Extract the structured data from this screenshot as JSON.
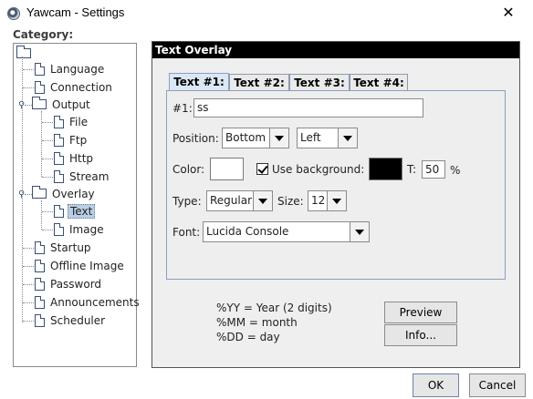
{
  "window": {
    "title": "Yawcam - Settings",
    "close": "✕"
  },
  "category_label": "Category:",
  "tree": {
    "items": {
      "language": "Language",
      "connection": "Connection",
      "output": "Output",
      "file": "File",
      "ftp": "Ftp",
      "http": "Http",
      "stream": "Stream",
      "overlay": "Overlay",
      "text": "Text",
      "image": "Image",
      "startup": "Startup",
      "offline_image": "Offline Image",
      "password": "Password",
      "announcements": "Announcements",
      "scheduler": "Scheduler"
    },
    "selected": "text"
  },
  "panel": {
    "title": "Text Overlay",
    "tabs": [
      "Text #1:",
      "Text #2:",
      "Text #3:",
      "Text #4:"
    ],
    "active_tab": 0,
    "text_label": "#1:",
    "text_value": "ss",
    "position_label": "Position:",
    "position_vertical": "Bottom",
    "position_horizontal": "Left",
    "color_label": "Color:",
    "text_color": "#ffffff",
    "use_background_label": "Use background:",
    "use_background_checked": true,
    "background_color": "#000000",
    "transparency_label": "T:",
    "transparency_value": "50",
    "transparency_unit": "%",
    "type_label": "Type:",
    "type_value": "Regular",
    "size_label": "Size:",
    "size_value": "12",
    "font_label": "Font:",
    "font_value": "Lucida Console"
  },
  "help_lines": [
    "%YY = Year (2 digits)",
    "%MM = month",
    "%DD = day"
  ],
  "buttons": {
    "preview": "Preview",
    "info": "Info...",
    "ok": "OK",
    "cancel": "Cancel"
  }
}
